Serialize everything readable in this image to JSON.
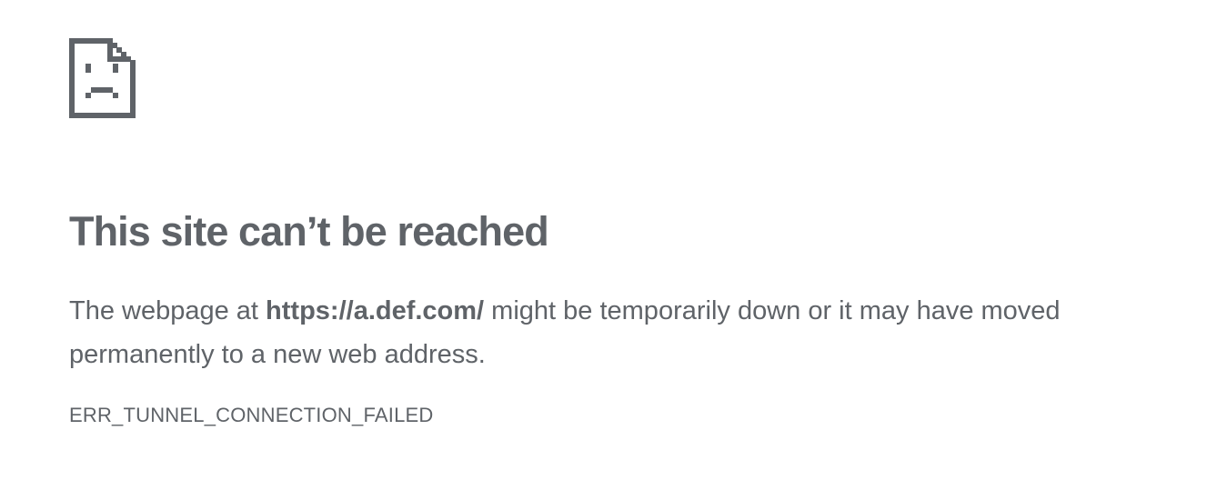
{
  "error_page": {
    "icon": "sad-document-icon",
    "heading": "This site can’t be reached",
    "description_prefix": "The webpage at ",
    "url": "https://a.def.com/",
    "description_suffix": " might be temporarily down or it may have moved permanently to a new web address.",
    "error_code": "ERR_TUNNEL_CONNECTION_FAILED",
    "text_color": "#5f6368",
    "background_color": "#ffffff"
  }
}
